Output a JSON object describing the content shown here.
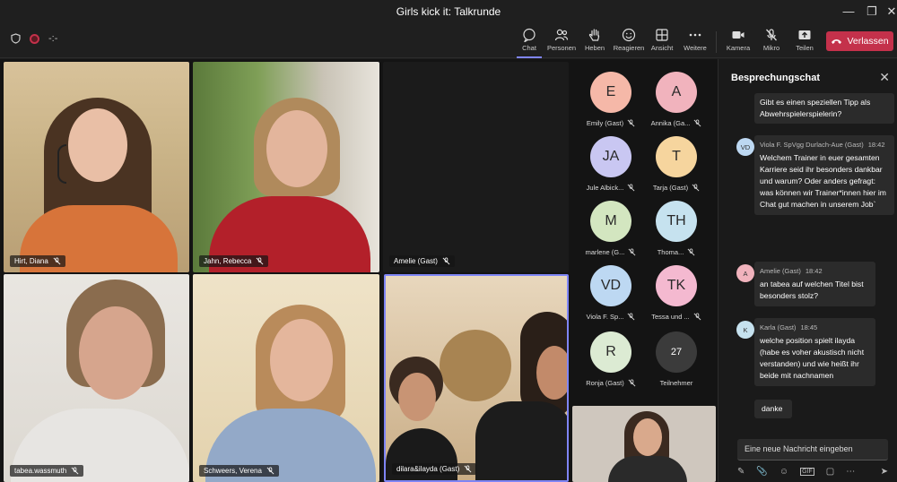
{
  "window": {
    "title": "Girls kick it: Talkrunde"
  },
  "toolbar": {
    "timer": "-:-",
    "buttons": [
      {
        "label": "Chat"
      },
      {
        "label": "Personen"
      },
      {
        "label": "Heben"
      },
      {
        "label": "Reagieren"
      },
      {
        "label": "Ansicht"
      },
      {
        "label": "Weitere"
      },
      {
        "label": "Kamera"
      },
      {
        "label": "Mikro"
      },
      {
        "label": "Teilen"
      }
    ],
    "leave_label": "Verlassen"
  },
  "tiles": [
    {
      "name": "Hirt, Diana"
    },
    {
      "name": "Jahn, Rebecca"
    },
    {
      "name": "Amelie (Gast)"
    },
    {
      "name": "tabea.wassmuth"
    },
    {
      "name": "Schweers, Verena"
    },
    {
      "name": "dilara&ilayda (Gast)"
    }
  ],
  "roster": [
    {
      "initials": "E",
      "name": "Emily (Gast)",
      "color": "#f5b8a8"
    },
    {
      "initials": "A",
      "name": "Annika (Ga...",
      "color": "#f1b3bd"
    },
    {
      "initials": "JA",
      "name": "Jule Albick...",
      "color": "#c9c7f2"
    },
    {
      "initials": "T",
      "name": "Tarja (Gast)",
      "color": "#f6d59e"
    },
    {
      "initials": "M",
      "name": "marlene (G...",
      "color": "#d3e6c0"
    },
    {
      "initials": "TH",
      "name": "Thoma...",
      "color": "#c6e2ef"
    },
    {
      "initials": "VD",
      "name": "Viola F. Sp...",
      "color": "#bdd8f2"
    },
    {
      "initials": "TK",
      "name": "Tessa und ...",
      "color": "#f4b9d0"
    },
    {
      "initials": "R",
      "name": "Ronja (Gast)",
      "color": "#dcebd3"
    },
    {
      "initials": "27",
      "name": "Teilnehmer",
      "color": "#3b3b3b"
    }
  ],
  "chat": {
    "title": "Besprechungschat",
    "messages": [
      {
        "text": "Gibt es einen speziellen Tipp als Abwehrspielerspielerin?"
      },
      {
        "avatar": "VD",
        "author": "Viola F. SpVgg Durlach-Aue (Gast)",
        "time": "18:42",
        "text": "Welchem Trainer in euer gesamten Karriere seid ihr besonders dankbar und warum? Oder anders gefragt: was können wir Trainer*innen hier im Chat gut machen in unserem Job`"
      },
      {
        "avatar": "A",
        "author": "Amelie (Gast)",
        "time": "18:42",
        "text": "an tabea auf welchen Titel bist besonders stolz?"
      },
      {
        "avatar": "K",
        "author": "Karla (Gast)",
        "time": "18:45",
        "text": "welche position spielt ilayda (habe es voher akustisch nicht verstanden) und wie heißt ihr beide mit nachnamen"
      },
      {
        "text": "danke"
      }
    ],
    "compose_placeholder": "Eine neue Nachricht eingeben"
  }
}
